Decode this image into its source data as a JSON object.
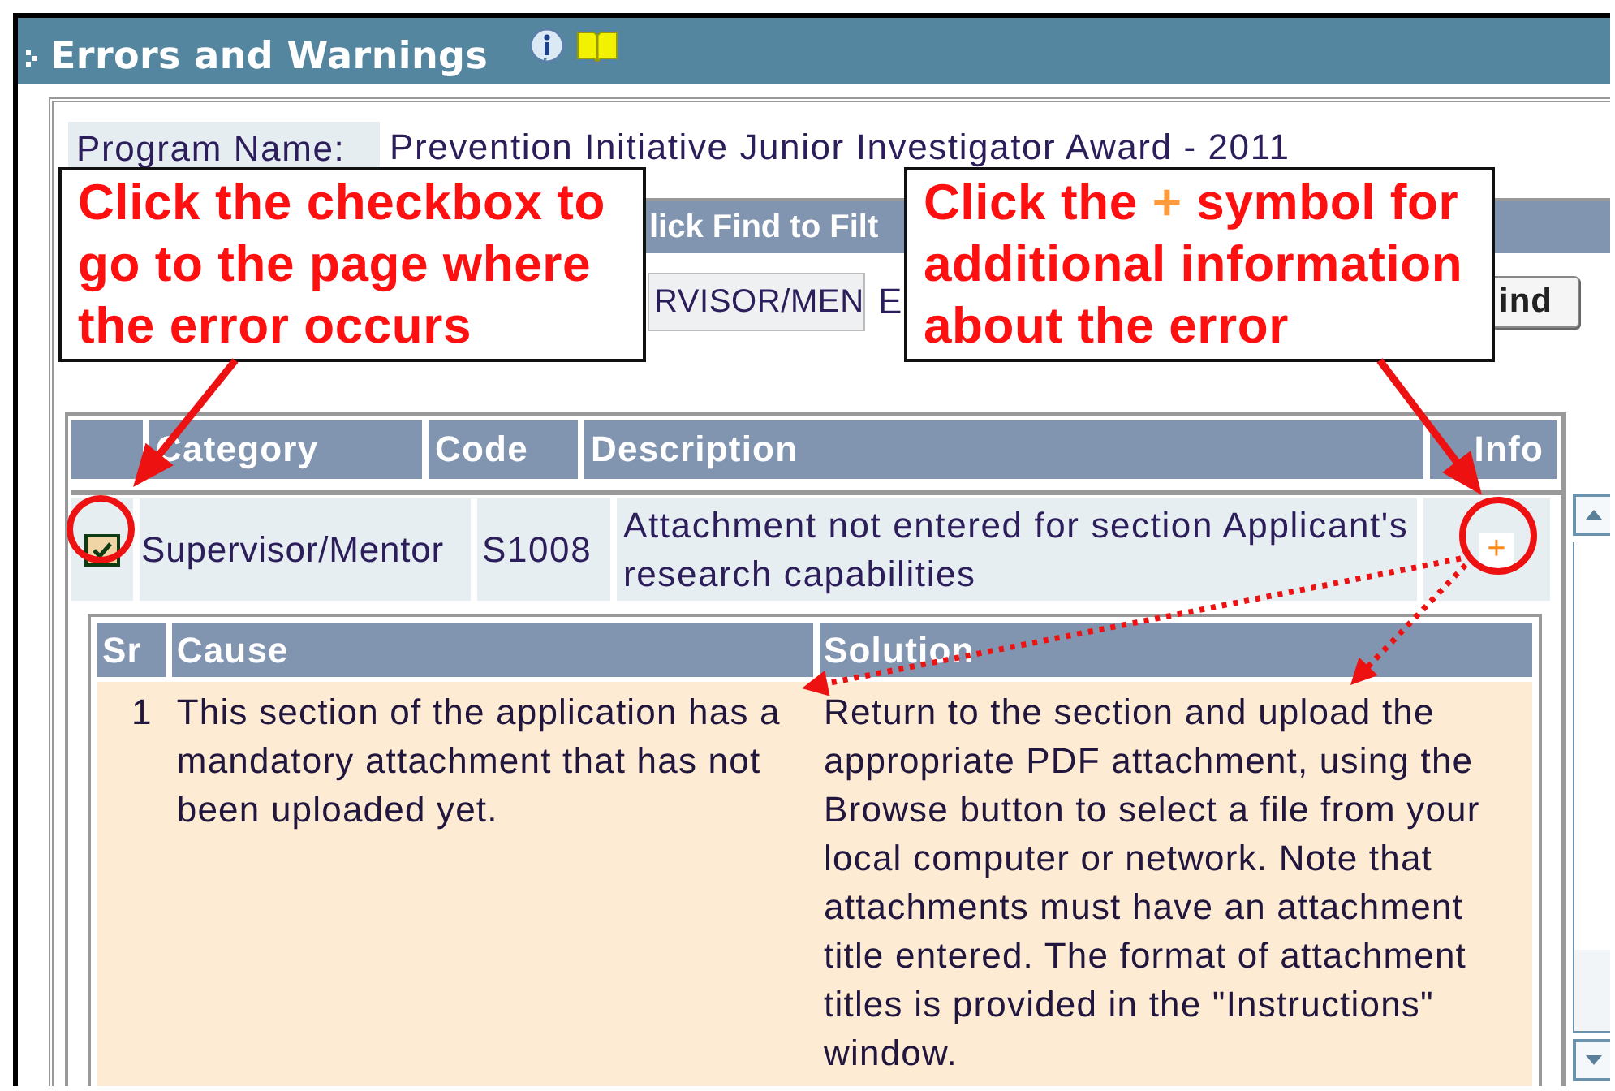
{
  "header": {
    "title": "Errors and Warnings"
  },
  "program": {
    "label": "Program Name:",
    "value": "Prevention Initiative Junior Investigator Award - 2011"
  },
  "filter": {
    "bar_text": "lick Find to Filt",
    "field_value": "RVISOR/MEN",
    "label_fragment": "E",
    "find_button": "ind"
  },
  "errors": {
    "columns": [
      {
        "label": "Category"
      },
      {
        "label": "Code"
      },
      {
        "label": "Description"
      },
      {
        "label": "Info"
      }
    ],
    "rows": [
      {
        "checked": true,
        "category": "Supervisor/Mentor",
        "code": "S1008",
        "description": "Attachment not entered for section Applicant's research capabilities",
        "info_symbol": "+",
        "expanded": true,
        "details": {
          "columns": [
            {
              "label": "Sr"
            },
            {
              "label": "Cause"
            },
            {
              "label": "Solution"
            }
          ],
          "rows": [
            {
              "sr": "1",
              "cause": "This section of the application has a mandatory attachment that has not been uploaded yet.",
              "solution": "Return to the section and upload the appropriate PDF attachment, using the Browse button to select a file from your local computer or network. Note that attachments must have an attachment title entered. The format of attachment titles is provided in the \"Instructions\" window."
            }
          ]
        }
      }
    ]
  },
  "callouts": [
    {
      "lines": [
        [
          {
            "text": "Click the checkbox to",
            "highlight": false
          }
        ],
        [
          {
            "text": "go to the page where",
            "highlight": false
          }
        ],
        [
          {
            "text": "the error occurs",
            "highlight": false
          }
        ]
      ]
    },
    {
      "lines": [
        [
          {
            "text": "Click the",
            "highlight": false
          },
          {
            "text": "+",
            "highlight": true
          },
          {
            "text": "symbol for",
            "highlight": false
          }
        ],
        [
          {
            "text": "additional information",
            "highlight": false
          }
        ],
        [
          {
            "text": "about the error",
            "highlight": false
          }
        ]
      ]
    }
  ]
}
